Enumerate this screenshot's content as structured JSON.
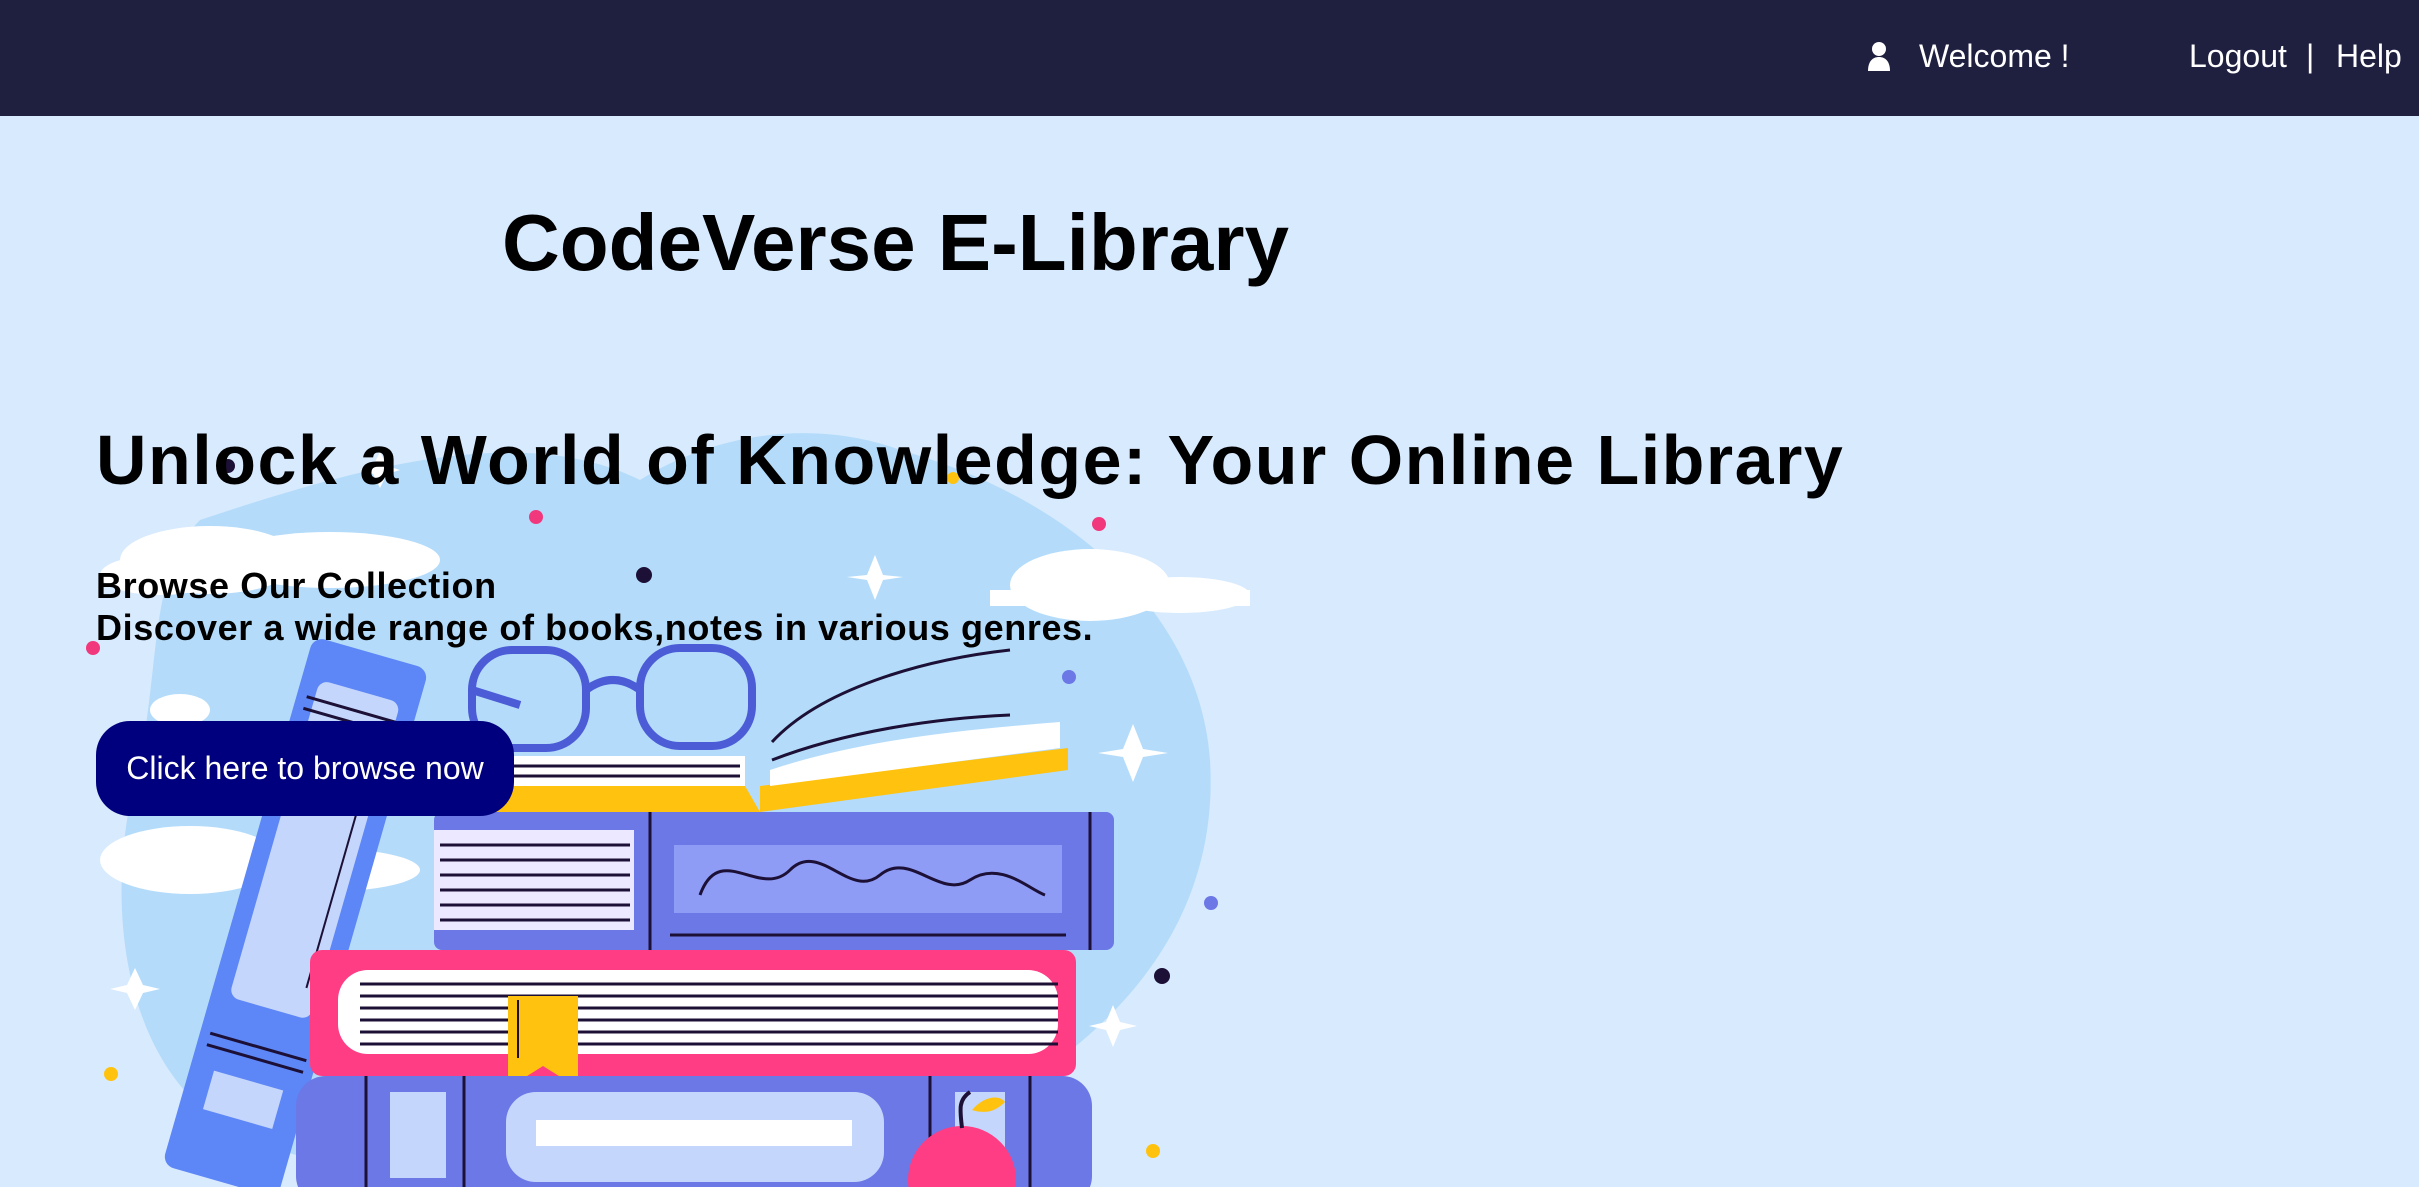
{
  "header": {
    "user_icon": "user-icon",
    "welcome_text": "Welcome !",
    "logout_label": "Logout",
    "separator": "|",
    "help_label": "Help"
  },
  "main": {
    "site_title": "CodeVerse E-Library",
    "hero_heading": "Unlock a World of Knowledge: Your Online Library",
    "sub_heading": "Browse Our Collection",
    "sub_text": "Discover a wide range of books,notes in various genres.",
    "browse_button_label": "Click here to browse now",
    "illustration": "books-stack-illustration"
  },
  "colors": {
    "header_bg": "#1f1f40",
    "page_bg": "#d8eafe",
    "button_bg": "#00007e",
    "book_blue": "#6b78e6",
    "book_pink": "#ff3d84",
    "book_yellow": "#ffc20e"
  }
}
